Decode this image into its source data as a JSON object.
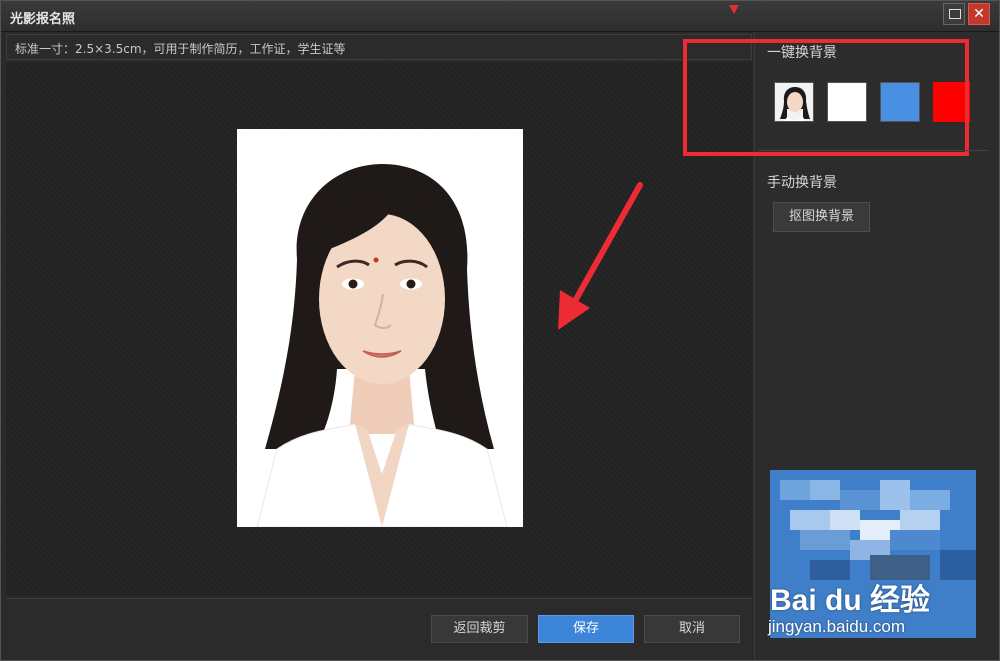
{
  "window": {
    "title": "光影报名照",
    "maximize_icon": "maximize-icon",
    "close_icon": "close-icon"
  },
  "info_bar": {
    "text": "标准一寸：2.5×3.5cm，可用于制作简历，工作证，学生证等"
  },
  "side_panel": {
    "one_click_bg": {
      "title": "一键换背景",
      "swatches": [
        {
          "name": "original-photo",
          "color": "#f2f2f2"
        },
        {
          "name": "white",
          "color": "#ffffff"
        },
        {
          "name": "blue",
          "color": "#4a90e2"
        },
        {
          "name": "red",
          "color": "#ff0000"
        }
      ]
    },
    "manual_bg": {
      "title": "手动换背景",
      "button": "抠图换背景"
    }
  },
  "buttons": {
    "back": "返回裁剪",
    "save": "保存",
    "cancel": "取消"
  },
  "watermark": {
    "logo": "Bai du 经验",
    "url": "jingyan.baidu.com"
  },
  "colors": {
    "accent": "#3d85d8",
    "highlight": "#ec2b35",
    "annotation_arrow": "#ec2b35"
  }
}
